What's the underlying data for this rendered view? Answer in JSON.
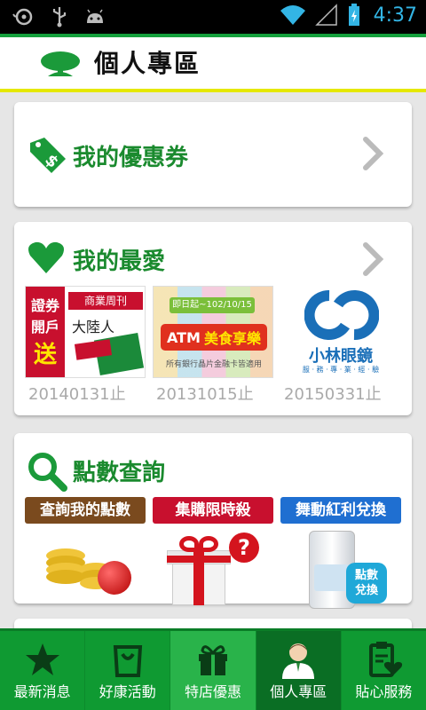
{
  "status_bar": {
    "time": "4:37"
  },
  "header": {
    "title": "個人專區"
  },
  "coupon_card": {
    "title": "我的優惠券"
  },
  "favorites_card": {
    "title": "我的最愛",
    "items": [
      {
        "thumb_text_a": "證券",
        "thumb_text_b": "開戶",
        "thumb_text_c": "送",
        "thumb_text_d": "商業周刊",
        "thumb_text_e": "大陸人",
        "date": "20140131止"
      },
      {
        "thumb_text_a": "即日起~102/10/15",
        "thumb_text_b": "ATM",
        "thumb_text_c": "美食享樂",
        "thumb_text_d": "所有銀行晶片金融卡皆適用",
        "date": "20131015止"
      },
      {
        "thumb_text_a": "小林眼鏡",
        "thumb_text_b": "服 · 務 · 專 · 業 · 經 · 驗",
        "date": "20150331止"
      }
    ]
  },
  "points_card": {
    "title": "點數查詢",
    "items": [
      {
        "label": "查詢我的點數",
        "color": "#7a4a1e"
      },
      {
        "label": "集購限時殺",
        "color": "#c8102e"
      },
      {
        "label": "舞動紅利兌換",
        "color": "#1f6fd1",
        "badge_a": "點數",
        "badge_b": "兌換"
      }
    ]
  },
  "bottom_nav": {
    "items": [
      {
        "label": "最新消息",
        "icon": "star-icon"
      },
      {
        "label": "好康活動",
        "icon": "shopping-bag-icon"
      },
      {
        "label": "特店優惠",
        "icon": "gift-icon"
      },
      {
        "label": "個人專區",
        "icon": "user-icon"
      },
      {
        "label": "貼心服務",
        "icon": "clipboard-heart-icon"
      }
    ],
    "active_index": 3
  },
  "colors": {
    "brand_green": "#14a03c",
    "header_yellow": "#e5e800",
    "title_green": "#1a8a2e",
    "nav_green": "#0f9a32"
  }
}
